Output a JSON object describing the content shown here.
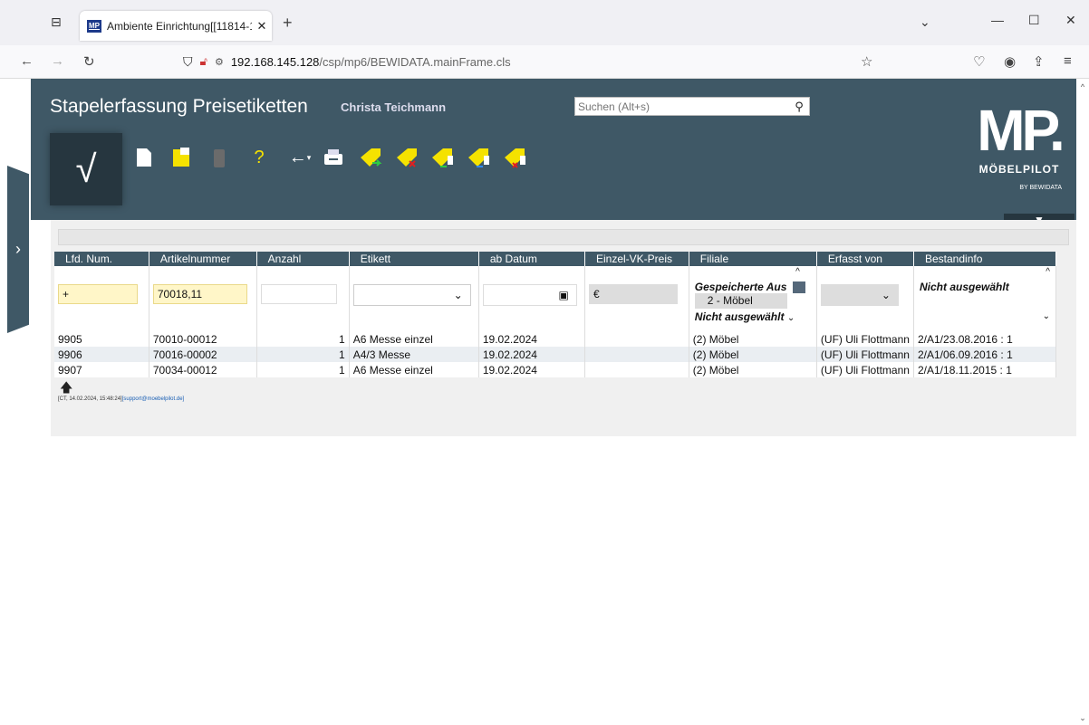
{
  "browser": {
    "tab_title": "Ambiente Einrichtung[[11814-1",
    "favicon_text": "MP",
    "new_tab": "+",
    "url_host": "192.168.145.128",
    "url_path": "/csp/mp6/BEWIDATA.mainFrame.cls"
  },
  "app": {
    "title": "Stapelerfassung Preisetiketten",
    "user": "Christa Teichmann",
    "search_placeholder": "Suchen (Alt+s)",
    "check_symbol": "√",
    "logo_mp": "MP.",
    "logo_name": "MÖBELPILOT",
    "logo_sub": "BY BEWIDATA"
  },
  "grid": {
    "columns": [
      "Lfd. Num.",
      "Artikelnummer",
      "Anzahl",
      "Etikett",
      "ab Datum",
      "Einzel-VK-Preis",
      "Filiale",
      "Erfasst von",
      "Bestandinfo"
    ],
    "edit_row": {
      "lfd_num": "+",
      "artikelnummer": "70018,11",
      "anzahl": "",
      "einzelpreis_currency": "€",
      "filiale_title": "Gespeicherte Aus",
      "filiale_option": "2 - Möbel",
      "filiale_none": "Nicht ausgewählt",
      "bestandinfo_none": "Nicht ausgewählt"
    },
    "rows": [
      {
        "lfd": "9905",
        "artikel": "70010-00012",
        "anzahl": "1",
        "etikett": "A6 Messe einzel",
        "datum": "19.02.2024",
        "preis": "",
        "filiale": "(2) Möbel",
        "erfasst": "(UF) Uli Flottmann",
        "bestand": "2/A1/23.08.2016 : 1"
      },
      {
        "lfd": "9906",
        "artikel": "70016-00002",
        "anzahl": "1",
        "etikett": "A4/3 Messe",
        "datum": "19.02.2024",
        "preis": "",
        "filiale": "(2) Möbel",
        "erfasst": "(UF) Uli Flottmann",
        "bestand": "2/A1/06.09.2016 : 1"
      },
      {
        "lfd": "9907",
        "artikel": "70034-00012",
        "anzahl": "1",
        "etikett": "A6 Messe einzel",
        "datum": "19.02.2024",
        "preis": "",
        "filiale": "(2) Möbel",
        "erfasst": "(UF) Uli Flottmann",
        "bestand": "2/A1/18.11.2015 : 1"
      }
    ]
  },
  "footer": {
    "stamp": "[CT, 14.02.2024, 15:48:24]",
    "email": "[support@moebelpilot.de]"
  },
  "colors": {
    "header": "#3f5866",
    "accent_yellow": "#f5e200"
  }
}
